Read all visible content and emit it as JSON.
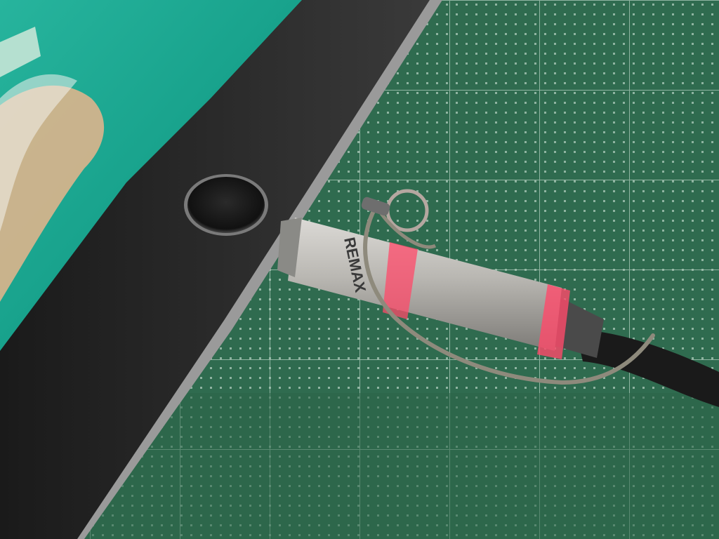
{
  "photo": {
    "subject": "ipad-edge-with-charging-adapter",
    "brand_text": "REMAX",
    "colors": {
      "cutting_mat": "#2f6b4f",
      "mat_grid_line": "#a9c8b6",
      "tablet_bezel": "#161616",
      "screen_teal": "#1fa38f",
      "screen_sand": "#e8b58c",
      "adapter_silver": "#b9b7b2",
      "indicator_ring": "#ff4a6a",
      "cable_black": "#1a1a1a",
      "lanyard_cord": "#8e8a7c"
    }
  }
}
